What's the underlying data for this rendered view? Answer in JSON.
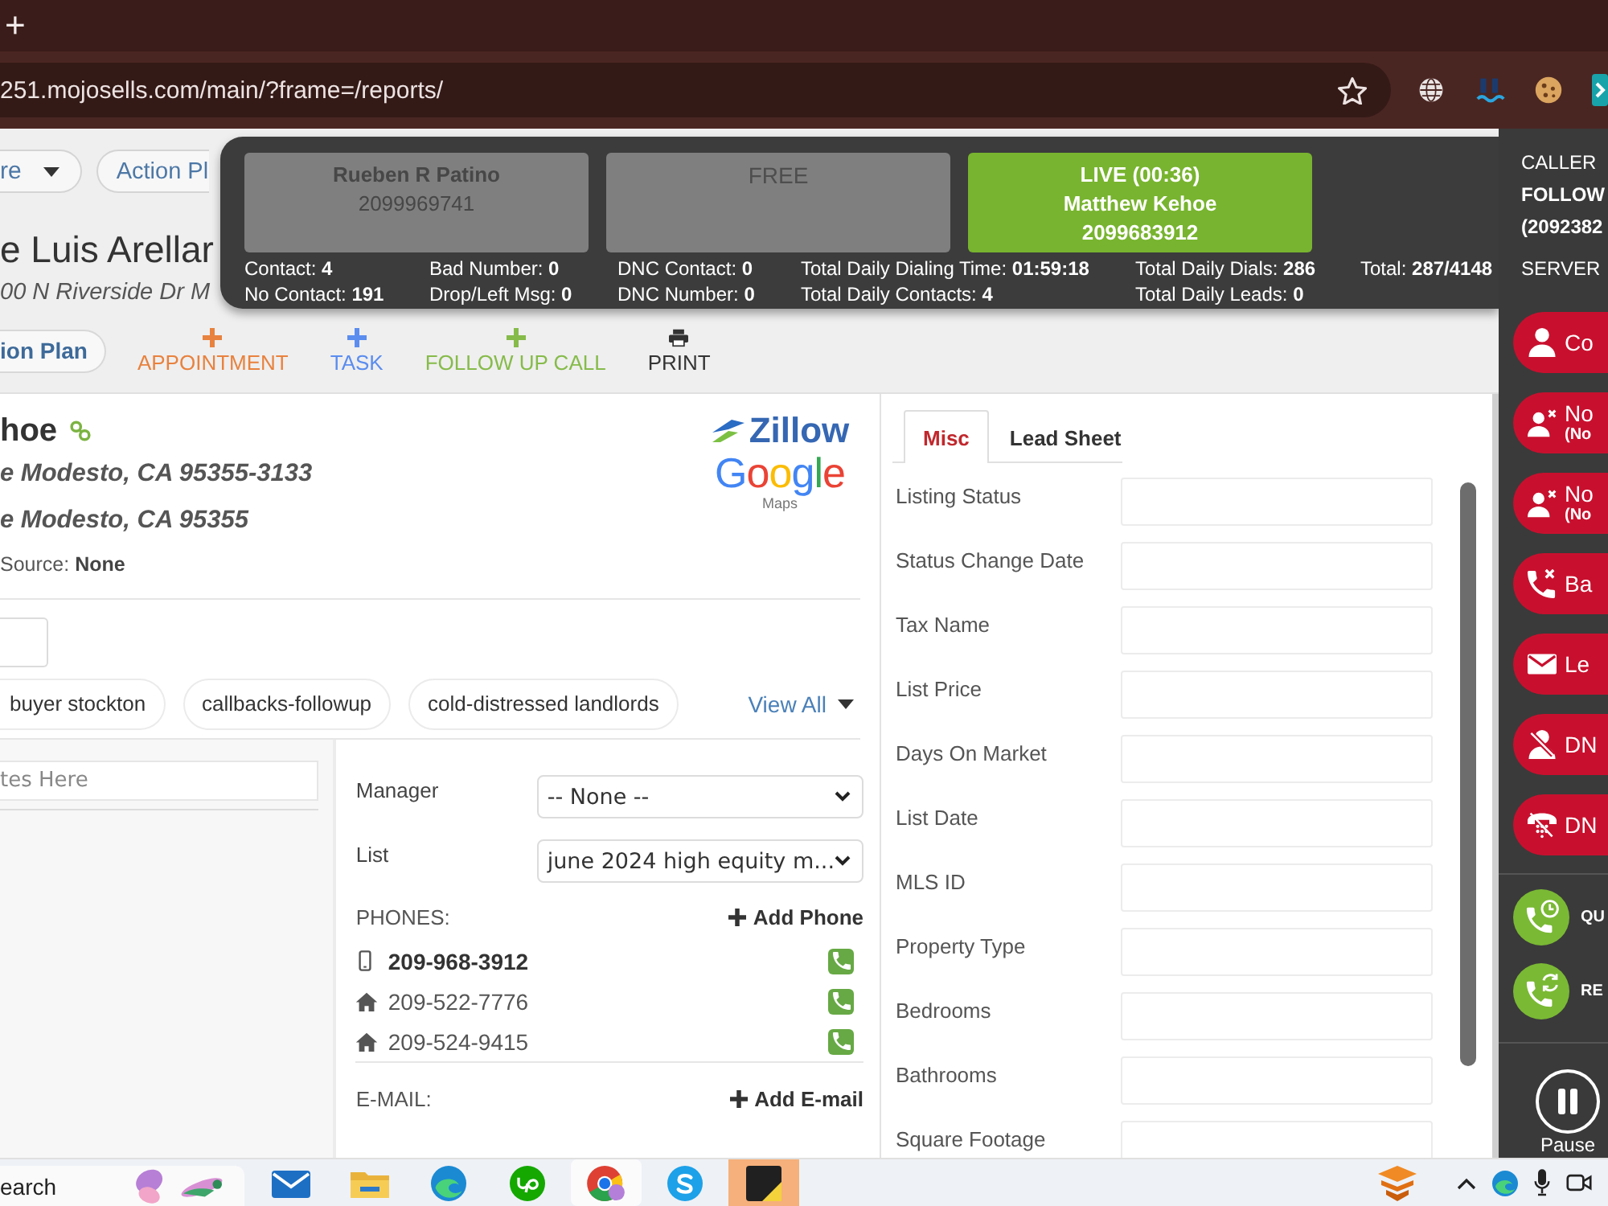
{
  "browser": {
    "new_tab": "+",
    "url": "251.mojosells.com/main/?frame=/reports/"
  },
  "header": {
    "menu": "re",
    "tab": "Action Pl",
    "title": "e Luis Arellar",
    "address": "00 N Riverside Dr M"
  },
  "toolbar": {
    "plan": "ion Plan",
    "actions": [
      {
        "kind": "add",
        "label": "APPOINTMENT",
        "color": "#e8823e"
      },
      {
        "kind": "add",
        "label": "TASK",
        "color": "#5b8def"
      },
      {
        "kind": "add",
        "label": "FOLLOW UP CALL",
        "color": "#86bb4a"
      },
      {
        "kind": "print",
        "label": "PRINT",
        "color": "#333333"
      }
    ]
  },
  "dialer": {
    "lines": [
      {
        "kind": "idle",
        "name": "Rueben R Patino",
        "number": "2099969741"
      },
      {
        "kind": "free",
        "status": "FREE"
      },
      {
        "kind": "live",
        "status": "LIVE (00:36)",
        "name": "Matthew Kehoe",
        "number": "2099683912"
      }
    ],
    "stats": [
      [
        {
          "label": "Contact:",
          "value": "4"
        },
        {
          "label": "No Contact:",
          "value": "191"
        }
      ],
      [
        {
          "label": "Bad Number:",
          "value": "0"
        },
        {
          "label": "Drop/Left Msg:",
          "value": "0"
        }
      ],
      [
        {
          "label": "DNC Contact:",
          "value": "0"
        },
        {
          "label": "DNC Number:",
          "value": "0"
        }
      ],
      [
        {
          "label": "Total Daily Dialing Time:",
          "value": "01:59:18"
        },
        {
          "label": "Total Daily Contacts:",
          "value": "4"
        }
      ],
      [
        {
          "label": "Total Daily Dials:",
          "value": "286"
        },
        {
          "label": "Total Daily Leads:",
          "value": "0"
        }
      ],
      [
        {
          "label": "Total:",
          "value": "287/4148"
        }
      ]
    ],
    "caller": {
      "label": "CALLER",
      "name": "FOLLOW",
      "number": "(2092382"
    },
    "server": "SERVER"
  },
  "contact": {
    "name": "hoe",
    "addresses": [
      "e Modesto, CA 95355-3133",
      "e Modesto, CA 95355"
    ],
    "source_label": "Source:",
    "source": "None",
    "maps": {
      "zillow": "Zillow",
      "google": "Google",
      "sub": "Maps"
    },
    "tags": [
      "buyer stockton",
      "callbacks-followup",
      "cold-distressed landlords"
    ],
    "view_all": "View All"
  },
  "notes": {
    "placeholder": "tes Here"
  },
  "details": {
    "manager": {
      "label": "Manager",
      "value": "-- None --"
    },
    "list": {
      "label": "List",
      "value": "june 2024 high equity m..."
    },
    "phones": {
      "heading": "PHONES:",
      "add": "Add Phone",
      "items": [
        {
          "kind": "mobile",
          "number": "209-968-3912",
          "primary": true
        },
        {
          "kind": "home",
          "number": "209-522-7776",
          "primary": false
        },
        {
          "kind": "home",
          "number": "209-524-9415",
          "primary": false
        }
      ]
    },
    "email": {
      "heading": "E-MAIL:",
      "add": "Add E-mail"
    }
  },
  "panel": {
    "tabs": [
      {
        "label": "Misc",
        "selected": true
      },
      {
        "label": "Lead Sheet",
        "selected": false
      }
    ],
    "fields": [
      "Listing Status",
      "Status Change Date",
      "Tax Name",
      "List Price",
      "Days On Market",
      "List Date",
      "MLS ID",
      "Property Type",
      "Bedrooms",
      "Bathrooms",
      "Square Footage"
    ]
  },
  "sidebar": {
    "dispositions": [
      {
        "kind": "user",
        "label": "Co"
      },
      {
        "kind": "userx",
        "label": "No",
        "note": "(No"
      },
      {
        "kind": "userx",
        "label": "No",
        "note": "(No"
      },
      {
        "kind": "phonex",
        "label": "Ba"
      },
      {
        "kind": "mail",
        "label": "Le"
      },
      {
        "kind": "userslash",
        "label": "DN"
      },
      {
        "kind": "phoneslash",
        "label": "DN"
      }
    ],
    "quick": [
      {
        "kind": "clock",
        "label": "QU"
      },
      {
        "kind": "cycle",
        "label": "RE"
      }
    ],
    "pause": "Pause"
  },
  "taskbar": {
    "search": {
      "placeholder": "earch"
    },
    "apps": [
      {
        "kind": "mail",
        "active": false,
        "alert": false
      },
      {
        "kind": "folder",
        "active": false,
        "alert": false
      },
      {
        "kind": "swirl",
        "active": false,
        "alert": false
      },
      {
        "kind": "leaf",
        "active": false,
        "alert": false
      },
      {
        "kind": "ring",
        "active": true,
        "alert": false
      },
      {
        "kind": "chat",
        "active": false,
        "alert": false
      },
      {
        "kind": "notes",
        "active": false,
        "alert": true
      }
    ]
  }
}
